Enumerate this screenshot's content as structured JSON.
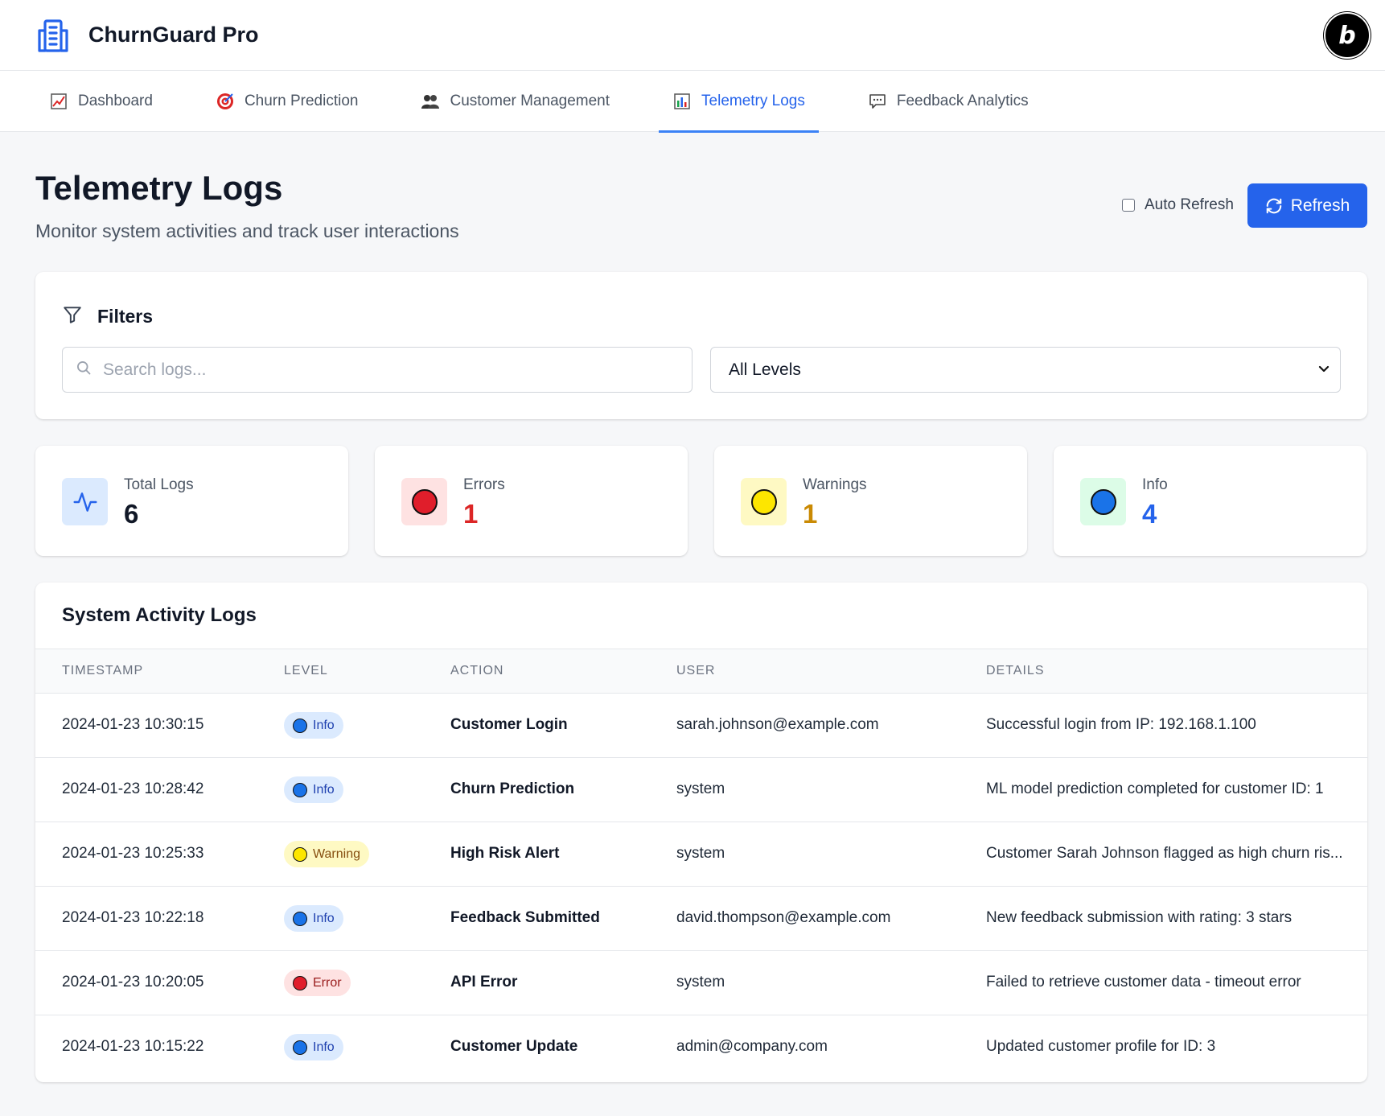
{
  "app": {
    "title": "ChurnGuard Pro",
    "badge_letter": "b"
  },
  "nav": {
    "tabs": [
      {
        "label": "Dashboard",
        "icon": "chart-icon",
        "active": false
      },
      {
        "label": "Churn Prediction",
        "icon": "target-icon",
        "active": false
      },
      {
        "label": "Customer Management",
        "icon": "users-icon",
        "active": false
      },
      {
        "label": "Telemetry Logs",
        "icon": "bar-chart-icon",
        "active": true
      },
      {
        "label": "Feedback Analytics",
        "icon": "speech-bubble-icon",
        "active": false
      }
    ]
  },
  "page": {
    "title": "Telemetry Logs",
    "subtitle": "Monitor system activities and track user interactions",
    "auto_refresh_label": "Auto Refresh",
    "auto_refresh_checked": false,
    "refresh_label": "Refresh"
  },
  "filters": {
    "title": "Filters",
    "search_placeholder": "Search logs...",
    "search_value": "",
    "level_selected": "All Levels"
  },
  "stats": [
    {
      "label": "Total Logs",
      "value": "6",
      "color": "#111827",
      "icon": "activity-icon",
      "icon_bg": "#dbeafe"
    },
    {
      "label": "Errors",
      "value": "1",
      "color": "#dc2626",
      "icon": "red-circle-icon",
      "icon_bg": "#fee2e2"
    },
    {
      "label": "Warnings",
      "value": "1",
      "color": "#ca8a04",
      "icon": "yellow-circle-icon",
      "icon_bg": "#fef9c3"
    },
    {
      "label": "Info",
      "value": "4",
      "color": "#2563eb",
      "icon": "blue-circle-icon",
      "icon_bg": "#dcfce7"
    }
  ],
  "logs": {
    "title": "System Activity Logs",
    "columns": [
      "TIMESTAMP",
      "LEVEL",
      "ACTION",
      "USER",
      "DETAILS"
    ],
    "rows": [
      {
        "timestamp": "2024-01-23 10:30:15",
        "level": "Info",
        "action": "Customer Login",
        "user": "sarah.johnson@example.com",
        "details": "Successful login from IP: 192.168.1.100"
      },
      {
        "timestamp": "2024-01-23 10:28:42",
        "level": "Info",
        "action": "Churn Prediction",
        "user": "system",
        "details": "ML model prediction completed for customer ID: 1"
      },
      {
        "timestamp": "2024-01-23 10:25:33",
        "level": "Warning",
        "action": "High Risk Alert",
        "user": "system",
        "details": "Customer Sarah Johnson flagged as high churn ris..."
      },
      {
        "timestamp": "2024-01-23 10:22:18",
        "level": "Info",
        "action": "Feedback Submitted",
        "user": "david.thompson@example.com",
        "details": "New feedback submission with rating: 3 stars"
      },
      {
        "timestamp": "2024-01-23 10:20:05",
        "level": "Error",
        "action": "API Error",
        "user": "system",
        "details": "Failed to retrieve customer data - timeout error"
      },
      {
        "timestamp": "2024-01-23 10:15:22",
        "level": "Info",
        "action": "Customer Update",
        "user": "admin@company.com",
        "details": "Updated customer profile for ID: 3"
      }
    ]
  }
}
